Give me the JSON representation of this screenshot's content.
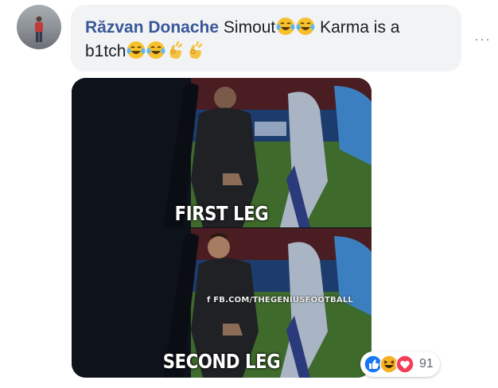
{
  "comment": {
    "author": "Răzvan Donache",
    "text_part1": "Simout",
    "text_part2": "Karma is a",
    "text_part3": "b1tch"
  },
  "image": {
    "panels": [
      {
        "caption": "FIRST LEG"
      },
      {
        "caption": "SECOND LEG",
        "watermark": "f FB.COM/THEGENIUSFOOTBALL"
      }
    ]
  },
  "reactions": {
    "icons": [
      "like-icon",
      "haha-icon",
      "love-icon"
    ],
    "count": "91"
  },
  "colors": {
    "author": "#385898",
    "bubble": "#f2f3f5",
    "like": "#1877f2",
    "love": "#f33e58",
    "haha": "#f7b125"
  }
}
